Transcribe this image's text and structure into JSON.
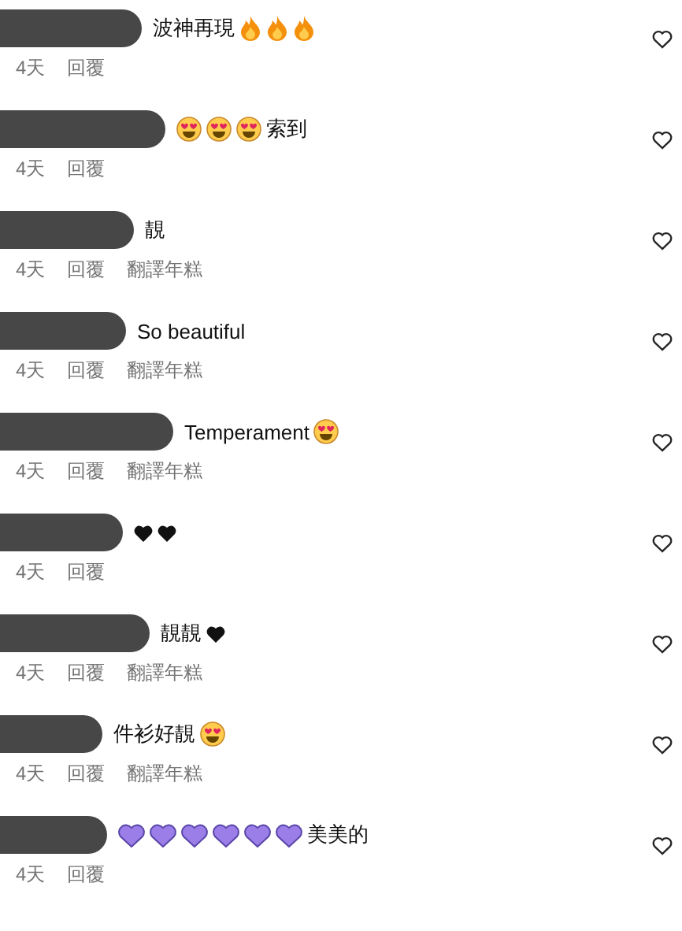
{
  "comments": [
    {
      "content": [
        {
          "kind": "text",
          "text": "波神再現"
        },
        {
          "kind": "fire"
        },
        {
          "kind": "fire"
        },
        {
          "kind": "fire"
        }
      ],
      "time": "4天",
      "reply": "回覆",
      "liked": false
    },
    {
      "content": [
        {
          "kind": "heart-eyes"
        },
        {
          "kind": "heart-eyes"
        },
        {
          "kind": "heart-eyes"
        },
        {
          "kind": "text",
          "text": "索到"
        }
      ],
      "time": "4天",
      "reply": "回覆",
      "liked": false
    },
    {
      "content": [
        {
          "kind": "text",
          "text": "靚"
        }
      ],
      "time": "4天",
      "reply": "回覆",
      "translate": "翻譯年糕",
      "liked": false
    },
    {
      "content": [
        {
          "kind": "text",
          "text": "So beautiful"
        }
      ],
      "time": "4天",
      "reply": "回覆",
      "translate": "翻譯年糕",
      "liked": false
    },
    {
      "content": [
        {
          "kind": "text",
          "text": "Temperament"
        },
        {
          "kind": "heart-eyes"
        }
      ],
      "time": "4天",
      "reply": "回覆",
      "translate": "翻譯年糕",
      "liked": false
    },
    {
      "content": [
        {
          "kind": "black-heart"
        },
        {
          "kind": "black-heart"
        }
      ],
      "time": "4天",
      "reply": "回覆",
      "liked": false
    },
    {
      "content": [
        {
          "kind": "text",
          "text": "靚靚"
        },
        {
          "kind": "black-heart"
        }
      ],
      "time": "4天",
      "reply": "回覆",
      "translate": "翻譯年糕",
      "liked": false
    },
    {
      "content": [
        {
          "kind": "text",
          "text": "件衫好靚"
        },
        {
          "kind": "heart-eyes"
        }
      ],
      "time": "4天",
      "reply": "回覆",
      "translate": "翻譯年糕",
      "liked": false
    },
    {
      "content": [
        {
          "kind": "purple-heart"
        },
        {
          "kind": "purple-heart"
        },
        {
          "kind": "purple-heart"
        },
        {
          "kind": "purple-heart"
        },
        {
          "kind": "purple-heart"
        },
        {
          "kind": "purple-heart"
        },
        {
          "kind": "text",
          "text": "美美的"
        }
      ],
      "time": "4天",
      "reply": "回覆",
      "liked": false
    }
  ]
}
